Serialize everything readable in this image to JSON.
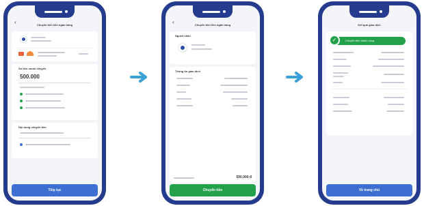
{
  "phone1": {
    "title": "Chuyển tiền liên ngân hàng",
    "amount": "500.000",
    "button": "Tiếp tục",
    "section_amount": "Số tiền muốn chuyển",
    "section_content": "Nội dung chuyển tiền"
  },
  "phone2": {
    "title": "Chuyển tiền liên ngân hàng",
    "section_to": "Người nhận",
    "section_info": "Thông tin giao dịch",
    "total": "500.000 đ",
    "button": "Chuyển tiền"
  },
  "phone3": {
    "title": "Kết quả giao dịch",
    "banner": "Chuyển tiền thành công",
    "button": "Về trang chủ"
  },
  "colors": {
    "frame": "#243b8e",
    "accent_blue": "#3c6fd1",
    "accent_green": "#22a04a",
    "arrow": "#3aa0d8"
  },
  "icons": [
    "back-arrow-icon",
    "avatar-icon",
    "right-arrow-icon",
    "check-circle-icon"
  ]
}
